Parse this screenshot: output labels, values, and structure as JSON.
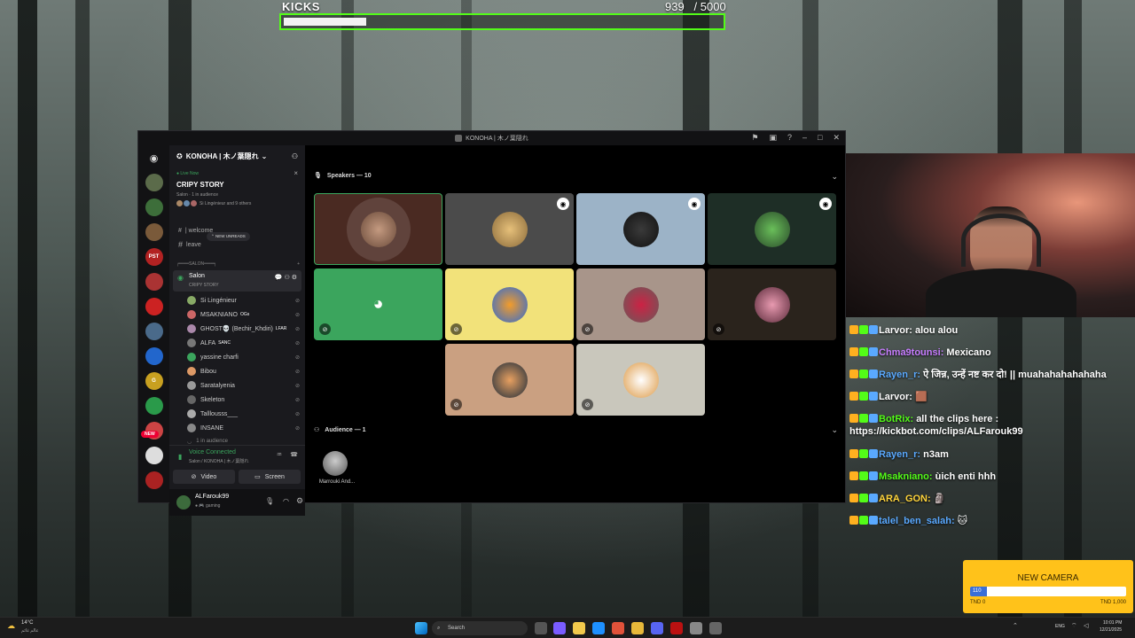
{
  "kicks": {
    "title": "KICKS",
    "current": "939",
    "goal": "/ 5000",
    "progress": 0.188
  },
  "discord": {
    "window_title": "KONOHA | 木ノ葉隠れ",
    "server_name": "KONOHA | 木ノ葉隠れ",
    "live": {
      "label": "Live Now",
      "title": "CRIPY STORY",
      "meta": "Salon · 1 in audience",
      "participants": "Si Lingénieur and 9 others"
    },
    "channels": {
      "welcome": "| welcome",
      "new_unreads": "NEW UNREADS",
      "leave": "leave",
      "salon_category": "╒═══SALON═══╕",
      "stage_name": "Salon",
      "stage_topic": "CRIPY STORY"
    },
    "members": [
      {
        "name": "Si Lingénieur",
        "tag": ""
      },
      {
        "name": "MSAKNIANO",
        "tag": "OGs"
      },
      {
        "name": "GHOST💀 (Bechir_Khdiri)",
        "tag": "LFAR"
      },
      {
        "name": "ALFA",
        "tag": "SANC"
      },
      {
        "name": "yassine charfi",
        "tag": ""
      },
      {
        "name": "Bibou",
        "tag": ""
      },
      {
        "name": "Saratalyenia",
        "tag": ""
      },
      {
        "name": "Skeleton",
        "tag": ""
      },
      {
        "name": "Talllousss___",
        "tag": ""
      },
      {
        "name": "INSANE",
        "tag": ""
      }
    ],
    "audience_count": "1 in audience",
    "voice": {
      "status": "Voice Connected",
      "location": "Salon / KONOHA | 木ノ葉隠れ",
      "video_label": "Video",
      "screen_label": "Screen"
    },
    "user": {
      "name": "ALFarouk99",
      "status": "gaming"
    },
    "new_badge": "NEW",
    "speakers_header": "Speakers — 10",
    "audience_header": "Audience — 1",
    "audience_member": "Marrouki And...",
    "colors": {
      "green": "#3ba55d",
      "blurple": "#5865f2",
      "accent_green": "#53fc18"
    }
  },
  "chat": [
    {
      "user": "Larvor",
      "color": "#ffffff",
      "text": "alou alou"
    },
    {
      "user": "Chma9tounsi",
      "color": "#c77dff",
      "text": "Mexicano"
    },
    {
      "user": "Rayen_r",
      "color": "#5aa9ff",
      "text": "ऐ जिन्न, उन्हें नष्ट कर दो! || muahahahahahaha"
    },
    {
      "user": "Larvor",
      "color": "#ffffff",
      "text": "🟫"
    },
    {
      "user": "BotRix",
      "color": "#53fc18",
      "text": "all the clips here :",
      "text2": "https://kickbot.com/clips/ALFarouk99"
    },
    {
      "user": "Rayen_r",
      "color": "#5aa9ff",
      "text": "n3am"
    },
    {
      "user": "Msakniano",
      "color": "#53fc18",
      "text": "ùich enti hhh"
    },
    {
      "user": "ARA_GON",
      "color": "#ffd43b",
      "text": "🗿"
    },
    {
      "user": "talel_ben_salah",
      "color": "#5aa9ff",
      "text": "🐱"
    }
  ],
  "camera_goal": {
    "title": "NEW CAMERA",
    "value": "110",
    "left": "TND 0",
    "right": "TND 1,000",
    "progress": 0.11
  },
  "taskbar": {
    "weather_temp": "14°C",
    "weather_desc": "عالم غائم",
    "search_placeholder": "Search",
    "lang": "ENG",
    "time": "10:01 PM",
    "date": "12/21/2025"
  }
}
